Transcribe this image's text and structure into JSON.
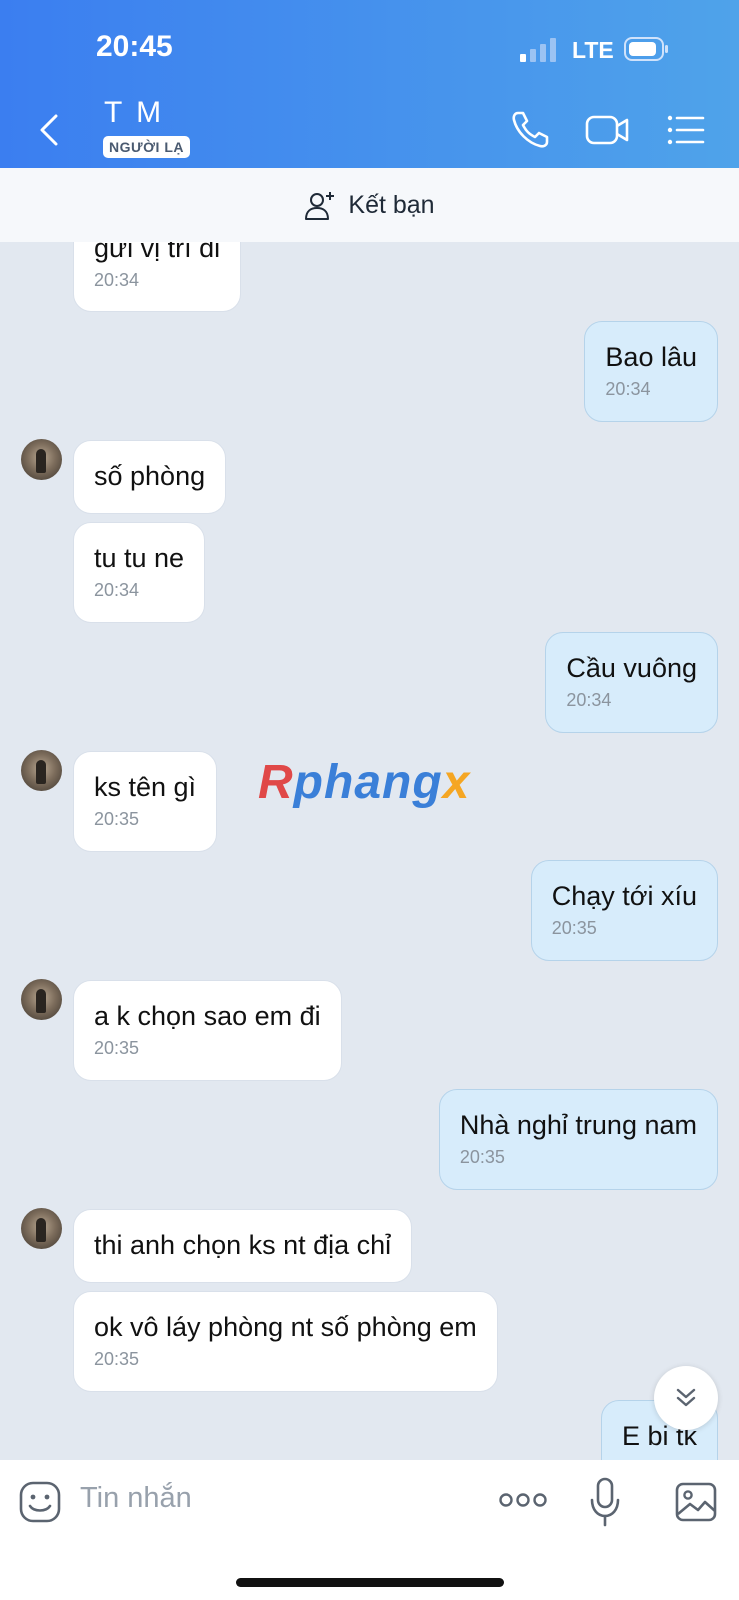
{
  "status_bar": {
    "time": "20:45",
    "network": "LTE"
  },
  "header": {
    "title": "T M",
    "badge": "NGƯỜI LẠ"
  },
  "friend_bar": {
    "label": "Kết bạn"
  },
  "watermark": {
    "part1": "R",
    "part2": "phang",
    "part3": "x"
  },
  "messages": [
    {
      "side": "in",
      "text": "gửi vị trí đi",
      "time": "20:34"
    },
    {
      "side": "out",
      "text": "Bao lâu",
      "time": "20:34"
    },
    {
      "side": "in",
      "text": "số phòng",
      "time": ""
    },
    {
      "side": "in",
      "text": "tu tu ne",
      "time": "20:34"
    },
    {
      "side": "out",
      "text": "Cầu vuông",
      "time": "20:34"
    },
    {
      "side": "in",
      "text": "ks tên gì",
      "time": "20:35"
    },
    {
      "side": "out",
      "text": "Chạy tới xíu",
      "time": "20:35"
    },
    {
      "side": "in",
      "text": "a k chọn sao em đi",
      "time": "20:35"
    },
    {
      "side": "out",
      "text": "Nhà nghỉ trung nam",
      "time": "20:35"
    },
    {
      "side": "in",
      "text": "thi anh chọn ks nt địa chỉ",
      "time": ""
    },
    {
      "side": "in",
      "text": "ok vô láy phòng nt số phòng em",
      "time": "20:35"
    },
    {
      "side": "out",
      "text": "E bi tk",
      "time": ""
    }
  ],
  "composer": {
    "placeholder": "Tin nhắn"
  },
  "icons": {
    "back": "chevron-left-icon",
    "call": "phone-icon",
    "video": "video-icon",
    "menu": "list-icon",
    "add_friend": "add-user-icon",
    "emoji": "emoji-icon",
    "more": "more-icon",
    "mic": "mic-icon",
    "gallery": "image-icon",
    "scroll": "double-chevron-down-icon"
  },
  "colors": {
    "header_start": "#3b7ef0",
    "header_end": "#4fa3ea",
    "outgoing_bubble": "#d7ecfb",
    "chat_bg": "#e2e8f0"
  }
}
